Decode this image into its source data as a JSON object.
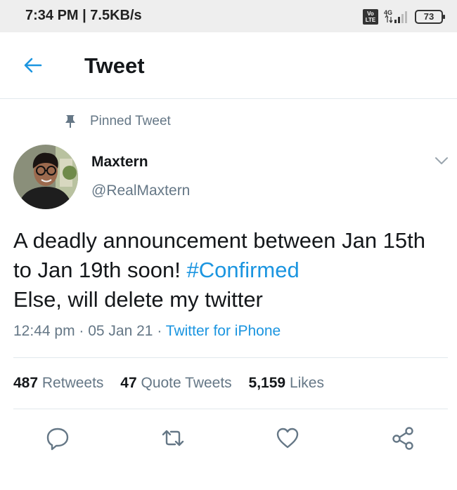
{
  "status_bar": {
    "time": "7:34 PM | 7.5KB/s",
    "network": "4G",
    "volte": [
      "Vo",
      "LTE"
    ],
    "battery": "73"
  },
  "header": {
    "title": "Tweet"
  },
  "tweet": {
    "pinned_label": "Pinned Tweet",
    "author_name": "Maxtern",
    "author_handle": "@RealMaxtern",
    "text_before": "A deadly announcement between Jan 15th to Jan 19th soon! ",
    "hashtag": "#Confirmed",
    "text_after": "Else, will delete my twitter",
    "time": "12:44 pm",
    "date": "05 Jan 21",
    "source": "Twitter for iPhone",
    "retweets_count": "487",
    "retweets_label": "Retweets",
    "quotes_count": "47",
    "quotes_label": "Quote Tweets",
    "likes_count": "5,159",
    "likes_label": "Likes"
  },
  "colors": {
    "accent": "#1b95e0",
    "secondary_text": "#657786",
    "divider": "#e1e8ed"
  },
  "icons": [
    "back-arrow-icon",
    "pin-icon",
    "chevron-down-icon",
    "reply-icon",
    "retweet-icon",
    "like-icon",
    "share-icon"
  ]
}
